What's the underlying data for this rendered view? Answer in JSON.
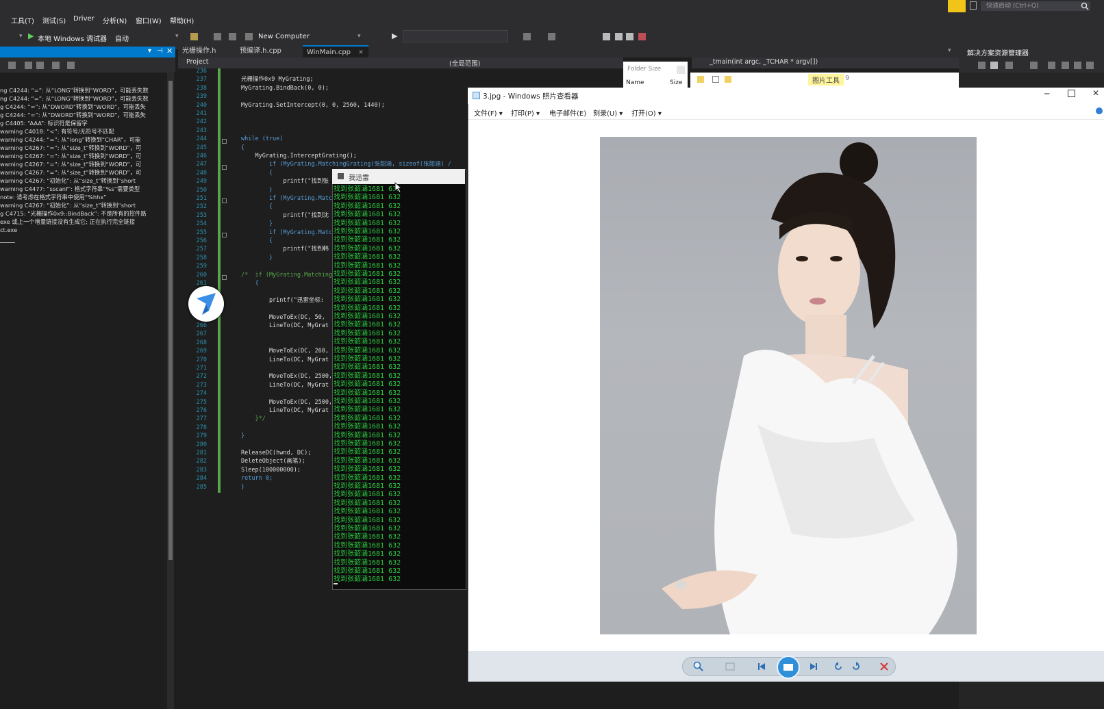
{
  "menubar": {
    "items": [
      "工具(T)",
      "测试(S)",
      "Driver",
      "分析(N)",
      "窗口(W)",
      "帮助(H)"
    ],
    "quick_launch_placeholder": "快速启动 (Ctrl+Q)"
  },
  "toolbar": {
    "debugger_label": "本地 Windows 调试器",
    "config_label": "自动",
    "target_label": "New Computer"
  },
  "editor": {
    "tabs": [
      {
        "label": "光栅操作.h"
      },
      {
        "label": "预编译.h.cpp"
      },
      {
        "label": "WinMain.cpp"
      }
    ],
    "nav": {
      "project": "Project",
      "scope": "(全局范围)",
      "function": "_tmain(int argc, _TCHAR * argv[])"
    },
    "line_numbers": [
      "236",
      "237",
      "238",
      "239",
      "240",
      "241",
      "242",
      "243",
      "244",
      "245",
      "246",
      "247",
      "248",
      "249",
      "250",
      "251",
      "252",
      "253",
      "254",
      "255",
      "256",
      "257",
      "258",
      "259",
      "260",
      "261",
      "262",
      "263",
      "264",
      "265",
      "266",
      "267",
      "268",
      "269",
      "270",
      "271",
      "272",
      "273",
      "274",
      "275",
      "276",
      "277",
      "278",
      "279",
      "280",
      "281",
      "282",
      "283",
      "284",
      "285"
    ],
    "code_lines": [
      {
        "line": 237,
        "text": "光栅操作0x9 MyGrating;"
      },
      {
        "line": 238,
        "text": "MyGrating.BindBack(0, 0);"
      },
      {
        "line": 240,
        "text": "MyGrating.SetIntercept(0, 0, 2560, 1440);"
      },
      {
        "line": 244,
        "text": "while (true)"
      },
      {
        "line": 245,
        "text": "{"
      },
      {
        "line": 246,
        "text": "    MyGrating.InterceptGrating();"
      },
      {
        "line": 247,
        "text": "        if (MyGrating.MatchingGrating(张韶涵, sizeof(张韶涵) /"
      },
      {
        "line": 248,
        "text": "        {"
      },
      {
        "line": 249,
        "text": "            printf(\"找到张"
      },
      {
        "line": 250,
        "text": "        }"
      },
      {
        "line": 251,
        "text": "        if (MyGrating.Matc"
      },
      {
        "line": 252,
        "text": "        {"
      },
      {
        "line": 253,
        "text": "            printf(\"找到沈"
      },
      {
        "line": 254,
        "text": "        }"
      },
      {
        "line": 255,
        "text": "        if (MyGrating.Matc"
      },
      {
        "line": 256,
        "text": "        {"
      },
      {
        "line": 257,
        "text": "            printf(\"找到韩"
      },
      {
        "line": 258,
        "text": "        }"
      },
      {
        "line": 260,
        "text": "/*  if (MyGrating.Matching"
      },
      {
        "line": 261,
        "text": "    {"
      },
      {
        "line": 263,
        "text": "        printf(\"迅雷坐标:"
      },
      {
        "line": 265,
        "text": "        MoveToEx(DC, 50, "
      },
      {
        "line": 266,
        "text": "        LineTo(DC, MyGrat"
      },
      {
        "line": 269,
        "text": "        MoveToEx(DC, 260, "
      },
      {
        "line": 270,
        "text": "        LineTo(DC, MyGrat"
      },
      {
        "line": 272,
        "text": "        MoveToEx(DC, 2500,"
      },
      {
        "line": 273,
        "text": "        LineTo(DC, MyGrat"
      },
      {
        "line": 275,
        "text": "        MoveToEx(DC, 2500,"
      },
      {
        "line": 276,
        "text": "        LineTo(DC, MyGrat"
      },
      {
        "line": 277,
        "text": "    }*/"
      },
      {
        "line": 279,
        "text": "}"
      },
      {
        "line": 281,
        "text": "ReleaseDC(hwnd, DC);"
      },
      {
        "line": 282,
        "text": "DeleteObject(画笔);"
      },
      {
        "line": 283,
        "text": "Sleep(100000000);"
      },
      {
        "line": 284,
        "text": "return 0;"
      },
      {
        "line": 285,
        "text": "}"
      }
    ]
  },
  "output_panel": {
    "lines": [
      "ng C4244: “=”: 从“LONG”转换到“WORD”，可能丢失数",
      "ng C4244: “=”: 从“LONG”转换到“WORD”，可能丢失数",
      "g C4244: “=”: 从“DWORD”转换到“WORD”，可能丢失",
      "g C4244: “=”: 从“DWORD”转换到“WORD”，可能丢失",
      "g C4405: “AAA”: 标识符是保留字",
      "warning C4018: “<”: 有符号/无符号不匹配",
      "warning C4244: “=”: 从“long”转换到“CHAR”，可能",
      "warning C4267: “=”: 从“size_t”转换到“WORD”，可",
      "warning C4267: “=”: 从“size_t”转换到“WORD”，可",
      "warning C4267: “=”: 从“size_t”转换到“WORD”，可",
      "warning C4267: “=”: 从“size_t”转换到“WORD”，可",
      "warning C4267: “初始化”: 从“size_t”转换到“short",
      "warning C4477: “sscanf”: 格式字符串“%s”需要类型",
      "note: 请考虑在格式字符串中使用“%hhx”",
      "warning C4267: “初始化”: 从“size_t”转换到“short",
      "g C4715: “光栅操作0x9::BindBack”: 不是所有的控件路",
      "exe 或上一个增量链接没有生成它; 正在执行完全链接",
      "ct.exe"
    ]
  },
  "console": {
    "title": "我迅雷",
    "line_text": "找到张韶涵1681 632",
    "line_count": 47
  },
  "photo_viewer": {
    "title": "3.jpg - Windows 照片查看器",
    "menu": [
      "文件(F)",
      "打印(P)",
      "电子邮件(E)",
      "刻录(U)",
      "打开(O)"
    ]
  },
  "background_windows": {
    "folder_size_label": "Folder Size",
    "col_name": "Name",
    "col_size": "Size",
    "picture_tools": "图片工具",
    "picture_tools_num": "9",
    "solution_explorer_title": "解决方案资源管理器"
  },
  "colors": {
    "accent": "#007acc",
    "console_text": "#2ecc40",
    "ide_bg": "#1e1e1e",
    "chrome_bg": "#2d2d30"
  }
}
